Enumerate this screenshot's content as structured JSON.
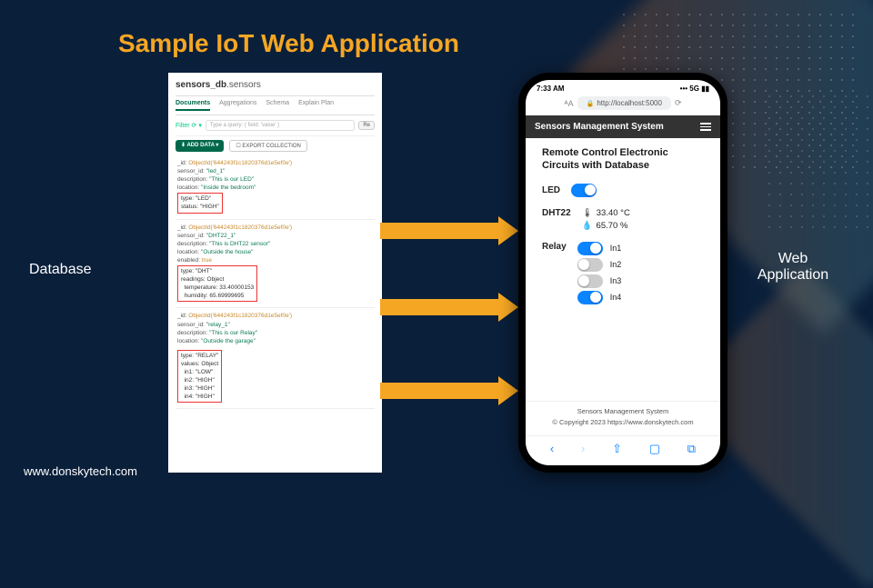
{
  "title": "Sample IoT Web Application",
  "labels": {
    "database": "Database",
    "webapp": "Web\nApplication"
  },
  "footer": "www.donskytech.com",
  "db": {
    "breadcrumb_db": "sensors_db",
    "breadcrumb_coll": ".sensors",
    "tabs": [
      "Documents",
      "Aggregations",
      "Schema",
      "Explain Plan"
    ],
    "filter_label": "Filter",
    "query_placeholder": "Type a query: { field: 'value' }",
    "reset": "Re",
    "add_data": "⬇ ADD DATA ▾",
    "export": "☐ EXPORT COLLECTION",
    "docs": [
      {
        "id": "ObjectId('644243f1c1820376d1e5ef0e')",
        "sensor_id": "\"led_1\"",
        "description": "\"This is our LED\"",
        "location": "\"Inside the bedroom\"",
        "box": "type: \"LED\"\nstatus: \"HIGH\""
      },
      {
        "id": "ObjectId('644243f1c1820376d1e5ef0e')",
        "sensor_id": "\"DHT22_1\"",
        "description": "\"This is DHT22 sensor\"",
        "location": "\"Outside the house\"",
        "enabled": "true",
        "box": "type: \"DHT\"\nreadings: Object\n  temperature: 33.40000153\n  humidity: 65.69999695"
      },
      {
        "id": "ObjectId('644243f1c1820376d1e5ef0e')",
        "sensor_id": "\"relay_1\"",
        "description": "\"This is our Relay\"",
        "location": "\"Outside the garage\"",
        "box": "type: \"RELAY\"\nvalues: Object\n  in1: \"LOW\"\n  in2: \"HIGH\"\n  in3: \"HIGH\"\n  in4: \"HIGH\""
      }
    ]
  },
  "phone": {
    "time": "7:33 AM",
    "signal": "••• 5G ▮▮",
    "url": "http://localhost:5000",
    "header": "Sensors Management System",
    "body_title": "Remote Control Electronic Circuits with Database",
    "led_label": "LED",
    "dht_label": "DHT22",
    "dht_temp": "33.40 °C",
    "dht_hum": "65.70 %",
    "relay_label": "Relay",
    "relay_ins": [
      {
        "label": "In1",
        "on": true
      },
      {
        "label": "In2",
        "on": false
      },
      {
        "label": "In3",
        "on": false
      },
      {
        "label": "In4",
        "on": true
      }
    ],
    "footer1": "Sensors Management System",
    "footer2": "© Copyright 2023 https://www.donskytech.com"
  }
}
